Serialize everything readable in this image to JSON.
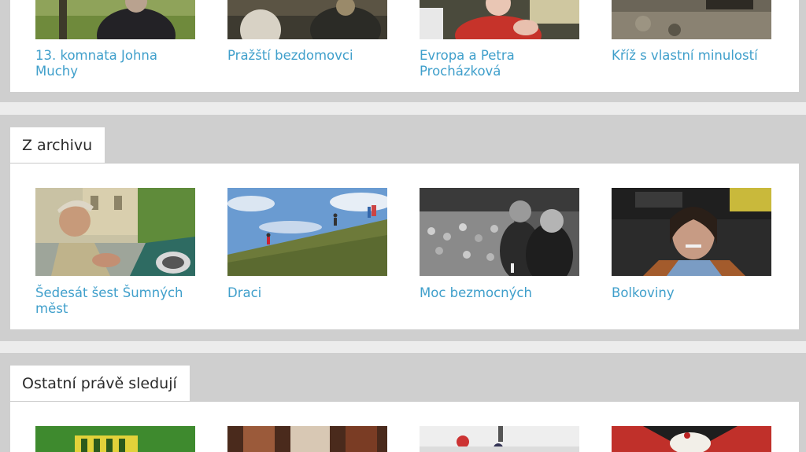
{
  "top_row": {
    "items": [
      {
        "title": "13. komnata Johna Muchy"
      },
      {
        "title": "Pražští bezdomovci"
      },
      {
        "title": "Evropa a Petra Procházková"
      },
      {
        "title": "Kříž s vlastní minulostí"
      }
    ]
  },
  "archive": {
    "heading": "Z archivu",
    "items": [
      {
        "title": "Šedesát šest Šumných měst"
      },
      {
        "title": "Draci"
      },
      {
        "title": "Moc bezmocných"
      },
      {
        "title": "Bolkoviny"
      }
    ]
  },
  "watching": {
    "heading": "Ostatní právě sledují"
  },
  "colors": {
    "link": "#3f9fcb",
    "band": "#cfcfcf",
    "page_bg": "#ececec"
  }
}
